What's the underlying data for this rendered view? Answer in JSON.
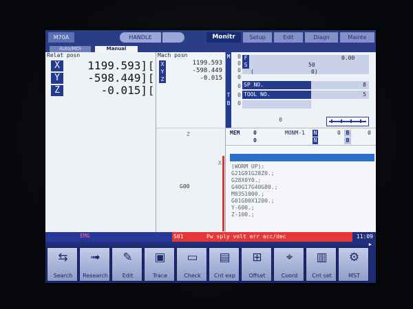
{
  "header": {
    "model": "M70A",
    "mode": "HANDLE",
    "active_tab": "Monitr",
    "tabs": [
      "Setup",
      "Edit",
      "Diagn",
      "Mainte"
    ]
  },
  "mode_tabs": [
    "Auto/MDI",
    "Manual"
  ],
  "relative": {
    "title": "Relat posn",
    "axes": [
      {
        "name": "X",
        "value": "1199.593]"
      },
      {
        "name": "Y",
        "value": "-598.449]"
      },
      {
        "name": "Z",
        "value": "-0.015]"
      }
    ],
    "bracket": "["
  },
  "machine": {
    "title": "Mach posn",
    "axes": [
      {
        "name": "X",
        "value": "1199.593"
      },
      {
        "name": "Y",
        "value": "-598.449"
      },
      {
        "name": "Z",
        "value": "-0.015"
      }
    ],
    "graph_z": "Z",
    "graph_x": "X",
    "g_code": "G00"
  },
  "codes": {
    "mstb": [
      "M",
      "S",
      "T",
      "B"
    ],
    "zeros": [
      "0",
      "0",
      "0",
      "0",
      "0",
      "0",
      "0",
      "0"
    ],
    "f_label": "F",
    "f_value": "0.00",
    "s_label": "S",
    "s_value": "50",
    "paren_left": "(",
    "paren_right": "0)",
    "sp_label": "SP NO.",
    "sp_value": "8",
    "tool_label": "TOOL NO.",
    "tool_value": "5",
    "bottom_zero": "0"
  },
  "mem": {
    "label": "MEM",
    "v1": "0",
    "v2": "0",
    "program": "MONM-1",
    "n1": "N",
    "n2": "N",
    "b_value": "0",
    "b1": "B",
    "b2": "B",
    "right_value": "0"
  },
  "program_lines": [
    "(WORM UP):",
    "G21G91G28Z0.;",
    "G28X0Y0.;",
    "G40G17G40G80.;",
    "M03S1000.;",
    "G01G00X1200.;",
    "Y-600.;",
    "Z-100.;"
  ],
  "alarm": {
    "left_code": "EMG",
    "code": "S01",
    "message": "Pw sply volt err acc/dec",
    "time": "11:09"
  },
  "softkeys": [
    {
      "label": "Search",
      "icon": "search-icon"
    },
    {
      "label": "Research",
      "icon": "research-icon"
    },
    {
      "label": "Edit",
      "icon": "edit-icon"
    },
    {
      "label": "Trace",
      "icon": "trace-icon"
    },
    {
      "label": "Check",
      "icon": "check-icon"
    },
    {
      "label": "Cnt exp",
      "icon": "counter-expand-icon"
    },
    {
      "label": "Offset",
      "icon": "offset-icon"
    },
    {
      "label": "Coord",
      "icon": "coord-icon"
    },
    {
      "label": "Cnt set",
      "icon": "counter-set-icon"
    },
    {
      "label": "MST",
      "icon": "mst-icon"
    }
  ],
  "colors": {
    "accent": "#2a3d86",
    "alarm": "#e63737",
    "highlight": "#2b6fc7"
  }
}
